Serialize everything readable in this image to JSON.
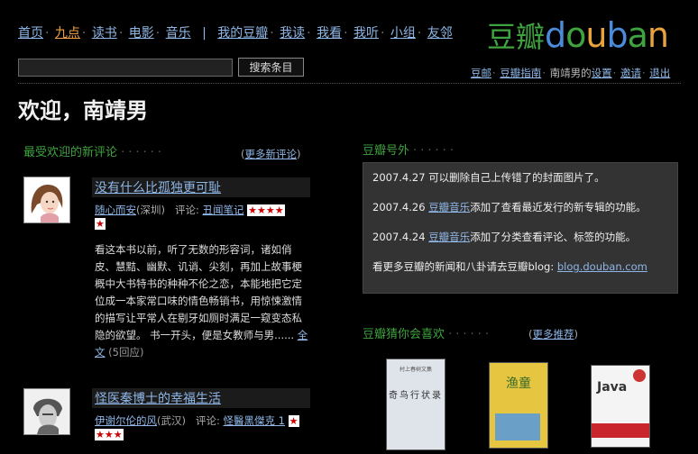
{
  "nav": {
    "items": [
      "首页",
      "九点",
      "读书",
      "电影",
      "音乐",
      "我的豆瓣",
      "我读",
      "我看",
      "我听",
      "小组",
      "友邻"
    ],
    "active": "九点",
    "separator": "|"
  },
  "logo": {
    "cn": "豆瓣",
    "en": "douban",
    "colors": {
      "cn": "#3fa33f",
      "d": "#4b8bd9",
      "o": "#3fa33f",
      "u": "#e8a33c",
      "b": "#4b8bd9",
      "a": "#3fa33f",
      "n": "#e8a33c"
    }
  },
  "search": {
    "value": "",
    "button": "搜索条目"
  },
  "toplinks": {
    "mail": "豆邮",
    "guide": "豆瓣指南",
    "user": "南靖男的",
    "settings": "设置",
    "invite": "邀请",
    "logout": "退出"
  },
  "welcome": "欢迎，南靖男",
  "reviews_section": {
    "title": "最受欢迎的新评论",
    "more": "更多新评论",
    "items": [
      {
        "title": "没有什么比孤独更可耻",
        "author": "随心而安",
        "location": "(深圳)",
        "comment_label": "评论:",
        "subject": "丑闻笔记",
        "rating": 4,
        "body": "看这本书以前，听了无数的形容词，诸如俏皮、慧黠、幽默、讥诮、尖刻，再加上故事梗概中大书特书的种种不伦之恋，本能地把它定位成一本家常口味的情色畅销书，用惊悚激情的描写让平常人在剔牙如厕时满足一窥变态私隐的欲望。 书一开头，便是女教师与男......",
        "full": "全文",
        "replies": "(5回应)"
      },
      {
        "title": "怪医秦博士的幸福生活",
        "author": "伊谢尔伦的风",
        "location": "(武汉)",
        "comment_label": "评论:",
        "subject": "怪醫黑傑克 1",
        "rating": 4
      }
    ]
  },
  "news_section": {
    "title": "豆瓣号外",
    "items": [
      {
        "date": "2007.4.27",
        "link": "",
        "text": "可以删除自己上传错了的封面图片了。"
      },
      {
        "date": "2007.4.26",
        "link": "豆瓣音乐",
        "text": "添加了查看最近发行的新专辑的功能。"
      },
      {
        "date": "2007.4.24",
        "link": "豆瓣音乐",
        "text": "添加了分类查看评论、标签的功能。"
      }
    ],
    "footer_text": "看更多豆瓣的新闻和八卦请去豆瓣blog:",
    "footer_link": "blog.douban.com"
  },
  "guess_section": {
    "title": "豆瓣猜你会喜欢",
    "more": "更多推荐",
    "books": [
      {
        "name": "book-cover-qiniao",
        "cover_text": "奇鸟行状录",
        "bg": "#dfe3ea"
      },
      {
        "name": "book-cover-yutong",
        "cover_text": "渔童",
        "bg": "#e6c640"
      },
      {
        "name": "book-cover-java",
        "cover_text": "Java",
        "bg": "#f4f4f4"
      }
    ]
  }
}
